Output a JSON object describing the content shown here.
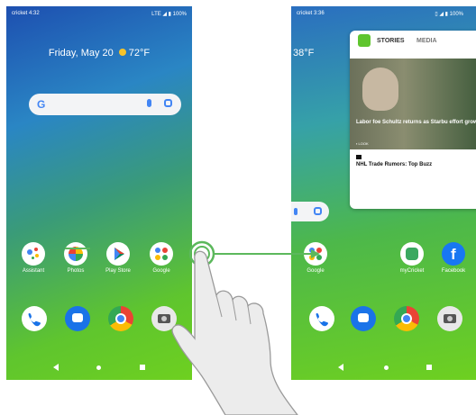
{
  "left_phone": {
    "status": {
      "carrier_time": "cricket 4:32",
      "signal_battery": "LTE ◢ ▮ 100%"
    },
    "date_weather": {
      "date": "Friday, May 20",
      "temp": "72°F"
    },
    "search": {
      "logo": "G"
    },
    "apps": [
      {
        "label": "Assistant",
        "color": "#ffffff"
      },
      {
        "label": "Photos",
        "color": "#ffffff"
      },
      {
        "label": "Play Store",
        "color": "#ffffff"
      },
      {
        "label": "Google",
        "color": "#ffffff"
      }
    ],
    "dock": [
      "phone-icon",
      "messages-icon",
      "chrome-icon",
      "camera-icon"
    ]
  },
  "right_phone": {
    "status": {
      "carrier_time": "cricket 3:36",
      "signal_battery": "▯ ◢ ▮ 100%"
    },
    "temp_partial": "38°F",
    "card": {
      "tab_stories": "STORIES",
      "tab_media": "MEDIA",
      "headline": "Labor foe Schultz returns as Starbu effort grows",
      "source": "▪ LOOK",
      "headline2": "NHL Trade Rumors: Top Buzz"
    },
    "apps": [
      {
        "label": "Google"
      },
      {
        "label": "myCricket"
      },
      {
        "label": "Facebook"
      }
    ]
  },
  "colors": {
    "connector": "#5cb85c",
    "accent_green": "#5fc52e"
  }
}
